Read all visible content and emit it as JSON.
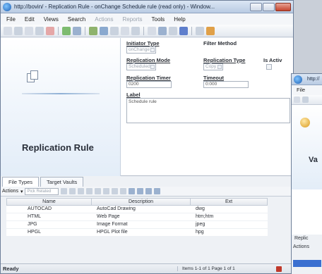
{
  "window": {
    "title": "http://bovin/ - Replication Rule - onChange Schedule rule (read only) - Window...",
    "menus": [
      {
        "label": "File",
        "dim": false
      },
      {
        "label": "Edit",
        "dim": false
      },
      {
        "label": "Views",
        "dim": false
      },
      {
        "label": "Search",
        "dim": false
      },
      {
        "label": "Actions",
        "dim": true
      },
      {
        "label": "Reports",
        "dim": true
      },
      {
        "label": "Tools",
        "dim": false
      },
      {
        "label": "Help",
        "dim": false
      }
    ]
  },
  "panel": {
    "title": "Replication Rule"
  },
  "form": {
    "initiator_type_label": "Initiator Type",
    "initiator_type_value": "onChange",
    "filter_method_label": "Filter Method",
    "replication_mode_label": "Replication Mode",
    "replication_mode_value": "Scheduled",
    "replication_type_label": "Replication Type",
    "replication_type_value": "Copy",
    "is_active_label": "Is Activ",
    "replication_timer_label": "Replication Timer",
    "replication_timer_value": "0200",
    "timeout_label": "Timeout",
    "timeout_value": "0:000",
    "label_label": "Label",
    "label_value": "Schedule rule"
  },
  "tabs": [
    {
      "label": "File Types",
      "active": true
    },
    {
      "label": "Target Vaults",
      "active": false
    }
  ],
  "actions": {
    "label": "Actions",
    "filter_value": "Pick Related"
  },
  "grid": {
    "columns": [
      "Name",
      "Description",
      "Ext"
    ],
    "rows": [
      {
        "name": "AUTOCAD",
        "description": "AutoCad Drawing",
        "ext": "dwg"
      },
      {
        "name": "HTML",
        "description": "Web Page",
        "ext": "htm;htm"
      },
      {
        "name": "JPG",
        "description": "Image Format",
        "ext": "jpeg"
      },
      {
        "name": "HPGL",
        "description": "HPGL Plot file",
        "ext": "hpg"
      }
    ]
  },
  "status": {
    "ready": "Ready",
    "items": "Items 1-1 of 1  Page 1 of 1"
  },
  "second_window": {
    "title": "http://",
    "menu_file": "File",
    "panel_label": "Va",
    "tab_label": "Replic",
    "actions_label": "Actions"
  }
}
